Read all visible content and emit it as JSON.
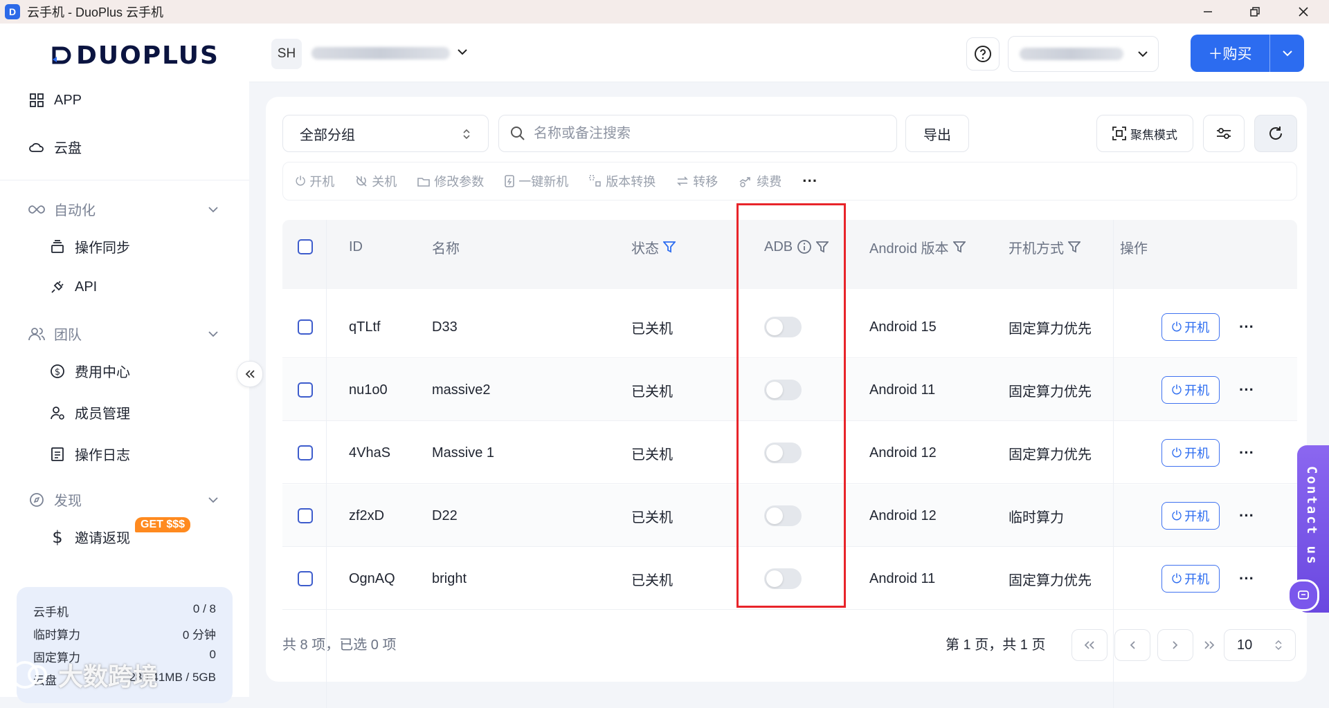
{
  "window": {
    "title": "云手机 - DuoPlus 云手机"
  },
  "brand": {
    "logo_text": "DUOPLUS",
    "accent": "#2c6cf0"
  },
  "sidebar": {
    "top_items": [
      {
        "label": "APP",
        "icon": "apps-grid-icon"
      },
      {
        "label": "云盘",
        "icon": "cloud-icon"
      }
    ],
    "groups": [
      {
        "label": "自动化",
        "icon": "infinity-icon",
        "items": [
          {
            "label": "操作同步",
            "icon": "layers-icon"
          },
          {
            "label": "API",
            "icon": "plug-icon"
          }
        ]
      },
      {
        "label": "团队",
        "icon": "users-icon",
        "items": [
          {
            "label": "费用中心",
            "icon": "dollar-circle-icon"
          },
          {
            "label": "成员管理",
            "icon": "user-manage-icon"
          },
          {
            "label": "操作日志",
            "icon": "log-icon"
          }
        ]
      },
      {
        "label": "发现",
        "icon": "compass-icon",
        "items": [
          {
            "label": "邀请返现",
            "icon": "dollar-icon",
            "badge": "GET $$$"
          }
        ]
      }
    ],
    "stats": [
      {
        "label": "云手机",
        "value": "0 / 8"
      },
      {
        "label": "临时算力",
        "value": "0 分钟"
      },
      {
        "label": "固定算力",
        "value": "0"
      },
      {
        "label": "云盘",
        "value": "289.41MB / 5GB"
      }
    ],
    "watermark": "大数跨境"
  },
  "header": {
    "avatar_initials": "SH",
    "buy_label": "＋购买"
  },
  "toolbar": {
    "group_select": "全部分组",
    "search_placeholder": "名称或备注搜索",
    "export_label": "导出",
    "focus_label": "聚焦模式",
    "actions": [
      {
        "label": "开机",
        "icon": "power-icon"
      },
      {
        "label": "关机",
        "icon": "power-off-icon"
      },
      {
        "label": "修改参数",
        "icon": "edit-params-icon"
      },
      {
        "label": "一键新机",
        "icon": "new-device-icon"
      },
      {
        "label": "版本转换",
        "icon": "version-switch-icon"
      },
      {
        "label": "转移",
        "icon": "transfer-icon"
      },
      {
        "label": "续费",
        "icon": "renew-icon"
      }
    ],
    "more": "···"
  },
  "table": {
    "columns": {
      "id": "ID",
      "name": "名称",
      "status": "状态",
      "adb": "ADB",
      "android": "Android 版本",
      "boot": "开机方式",
      "ops": "操作"
    },
    "rows": [
      {
        "id": "qTLtf",
        "name": "D33",
        "status": "已关机",
        "adb_enabled": false,
        "android": "Android 15",
        "boot": "固定算力优先",
        "action": "开机"
      },
      {
        "id": "nu1o0",
        "name": "massive2",
        "status": "已关机",
        "adb_enabled": false,
        "android": "Android 11",
        "boot": "固定算力优先",
        "action": "开机"
      },
      {
        "id": "4VhaS",
        "name": "Massive 1",
        "status": "已关机",
        "adb_enabled": false,
        "android": "Android 12",
        "boot": "固定算力优先",
        "action": "开机"
      },
      {
        "id": "zf2xD",
        "name": "D22",
        "status": "已关机",
        "adb_enabled": false,
        "android": "Android 12",
        "boot": "临时算力",
        "action": "开机"
      },
      {
        "id": "OgnAQ",
        "name": "bright",
        "status": "已关机",
        "adb_enabled": false,
        "android": "Android 11",
        "boot": "固定算力优先",
        "action": "开机"
      }
    ]
  },
  "footer": {
    "summary": "共 8 项，已选 0 项",
    "page_info": "第 1 页，共 1 页",
    "page_size": "10"
  },
  "contact": {
    "label": "Contact us"
  }
}
